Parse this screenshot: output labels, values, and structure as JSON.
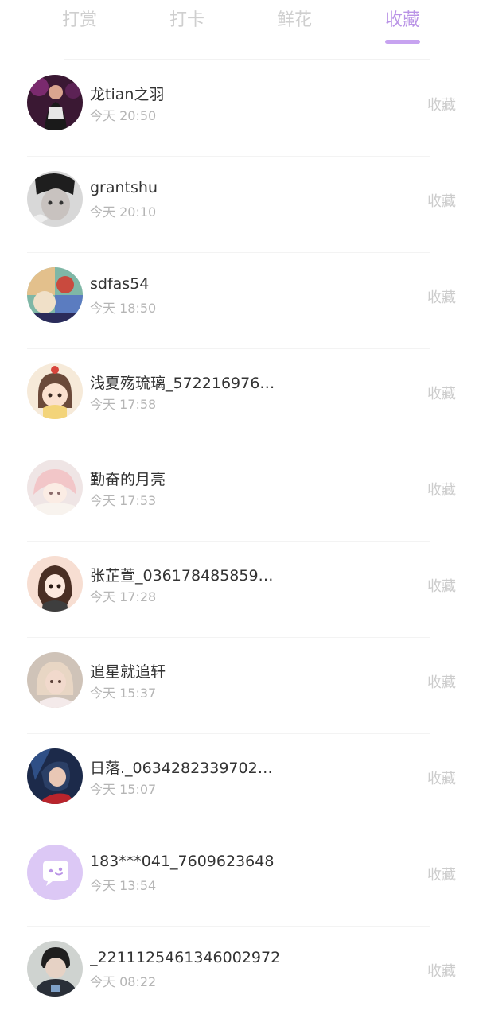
{
  "tabs": [
    {
      "label": "打赏",
      "active": false
    },
    {
      "label": "打卡",
      "active": false
    },
    {
      "label": "鲜花",
      "active": false
    },
    {
      "label": "收藏",
      "active": true
    }
  ],
  "accent_color": "#b993e6",
  "list": [
    {
      "name": "龙tian之羽",
      "time": "今天 20:50",
      "action": "收藏",
      "avatar": "photo-dark-purple"
    },
    {
      "name": "grantshu",
      "time": "今天 20:10",
      "action": "收藏",
      "avatar": "photo-grayscale"
    },
    {
      "name": "sdfas54",
      "time": "今天 18:50",
      "action": "收藏",
      "avatar": "cartoon-colorful"
    },
    {
      "name": "浅夏殇琉璃_572216976…",
      "time": "今天 17:58",
      "action": "收藏",
      "avatar": "anime-girl"
    },
    {
      "name": "勤奋的月亮",
      "time": "今天 17:53",
      "action": "收藏",
      "avatar": "anime-pink-hair"
    },
    {
      "name": "张芷萱_036178485859…",
      "time": "今天 17:28",
      "action": "收藏",
      "avatar": "illustration-girl"
    },
    {
      "name": "追星就追轩",
      "time": "今天 15:37",
      "action": "收藏",
      "avatar": "photo-blonde"
    },
    {
      "name": "日落._0634282339702…",
      "time": "今天 15:07",
      "action": "收藏",
      "avatar": "anime-dark-blue"
    },
    {
      "name": "183***041_7609623648",
      "time": "今天 13:54",
      "action": "收藏",
      "avatar": "default-chat-icon"
    },
    {
      "name": "_2211125461346002972",
      "time": "今天 08:22",
      "action": "收藏",
      "avatar": "photo-person"
    }
  ]
}
